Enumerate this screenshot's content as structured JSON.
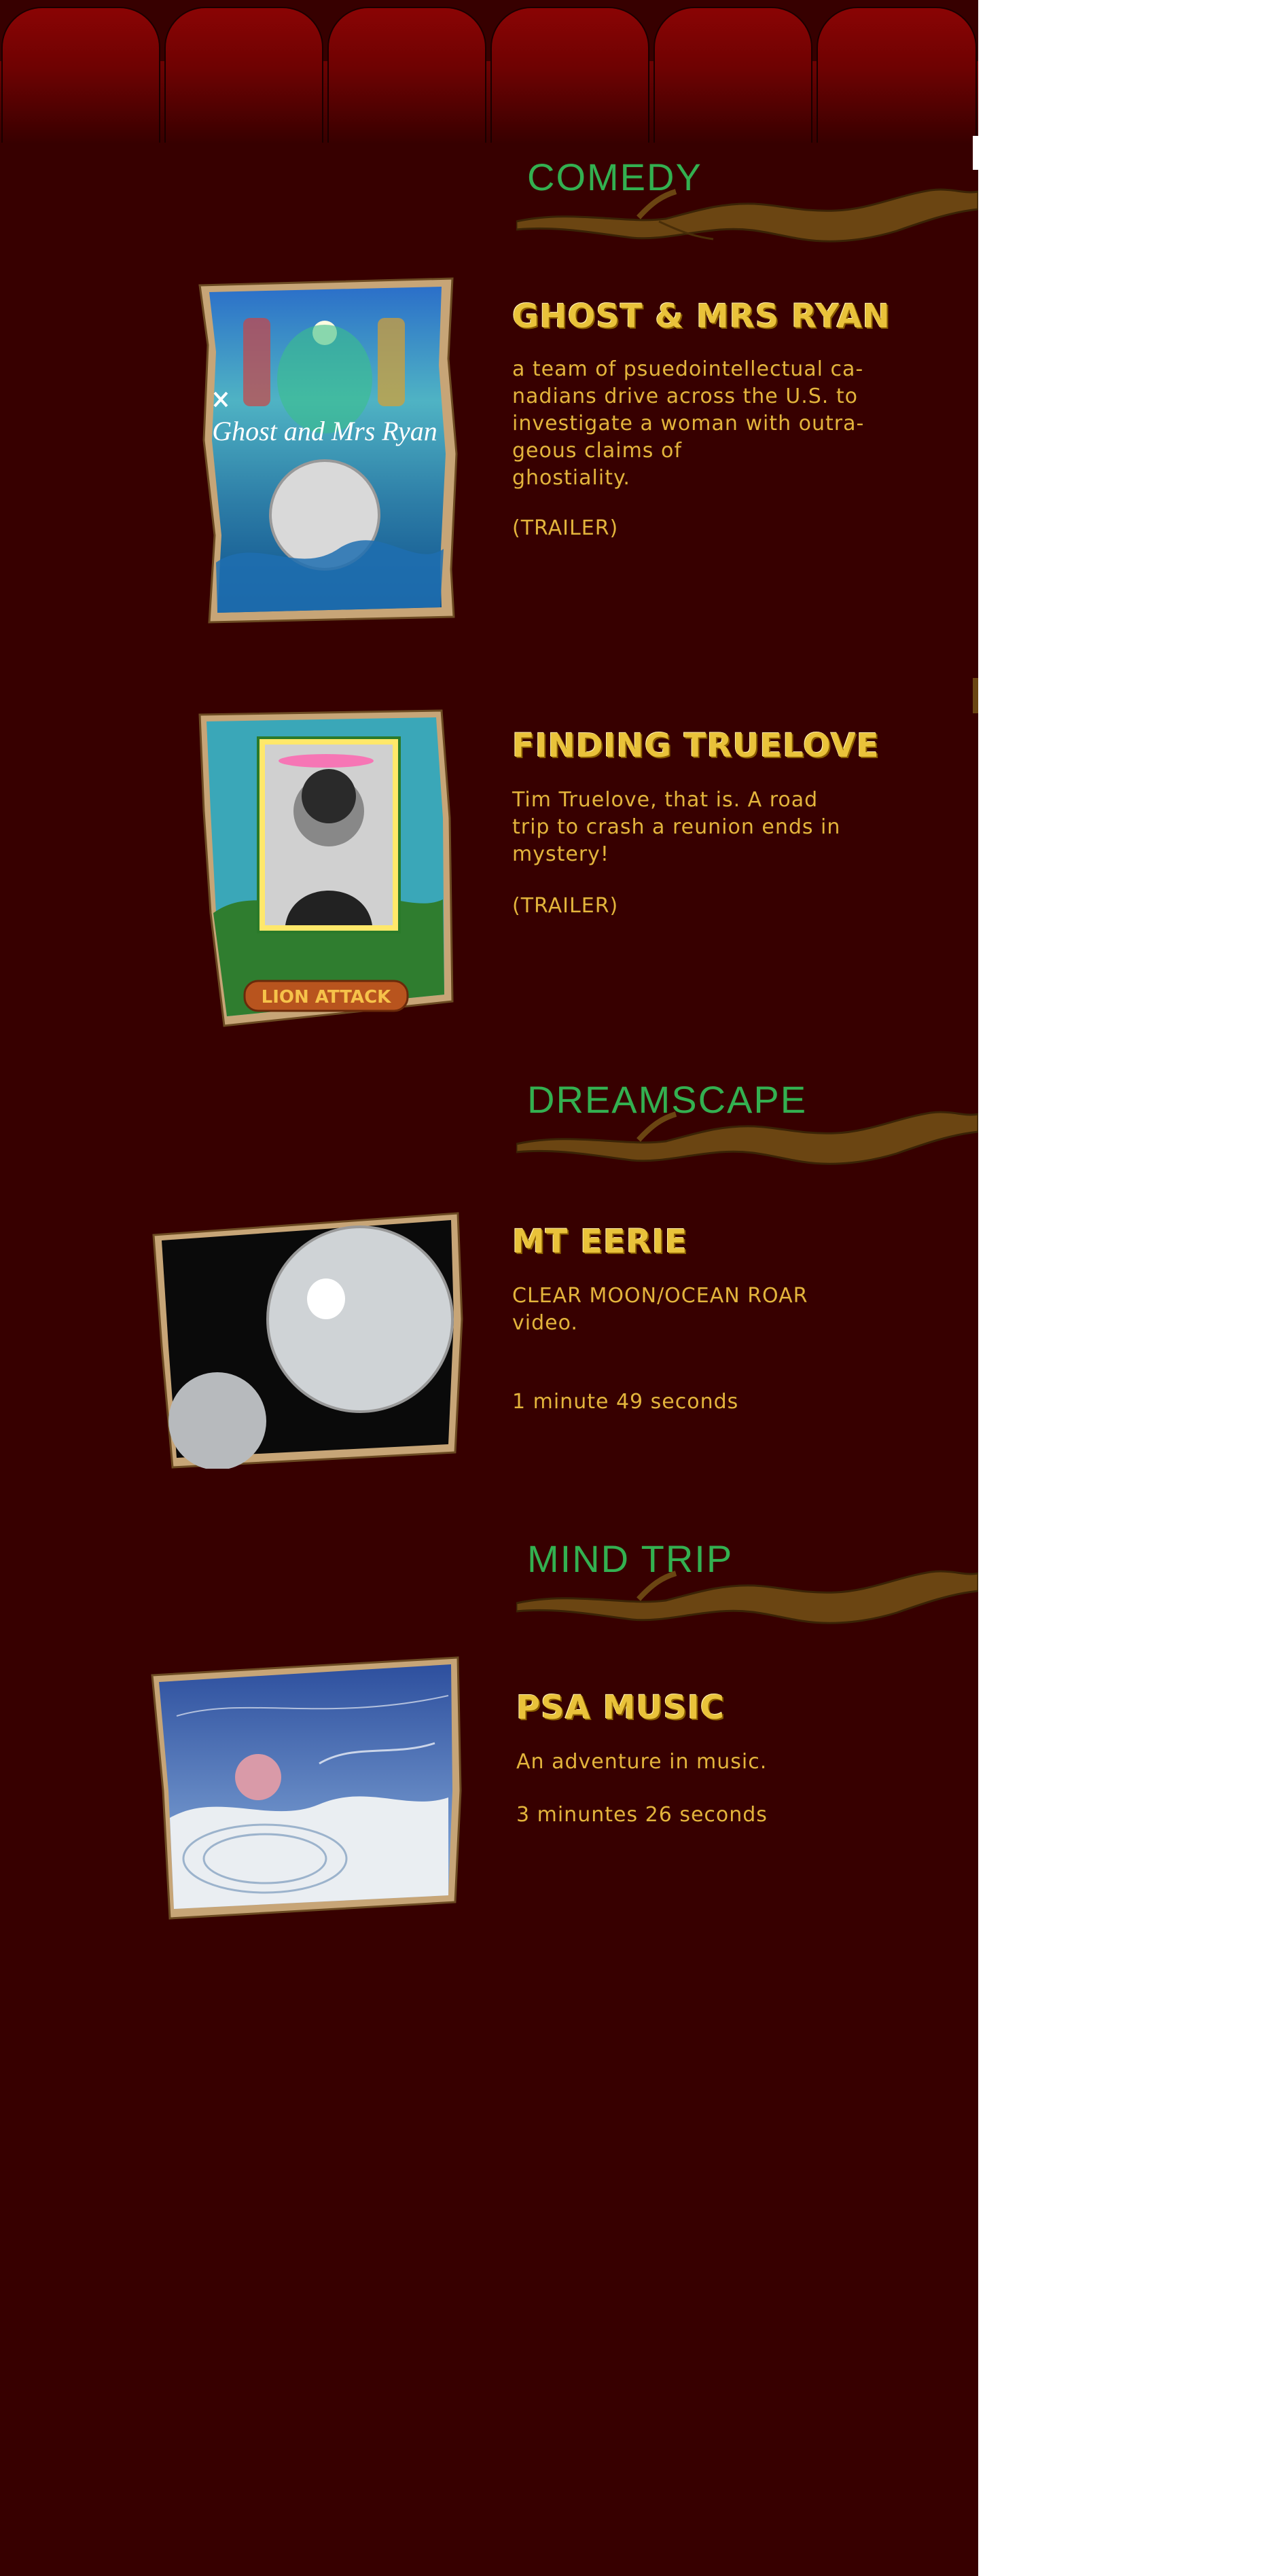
{
  "colors": {
    "panel": "#370000",
    "tab": "#8a0404",
    "section_title": "#33b050",
    "card_title": "#e9c23a",
    "card_text": "#e3b43c",
    "branch": "#6b4512"
  },
  "sections": [
    {
      "title": "COMEDY",
      "items": [
        {
          "title": "GHOST & MRS RYAN",
          "description_lines": [
            "a team of psuedointellectual ca-",
            "nadians drive across the U.S. to",
            "investigate a woman with outra-",
            "geous claims of",
            "ghostiality."
          ],
          "link": "(TRAILER)",
          "poster_text": "Ghost and Mrs Ryan"
        },
        {
          "title": "FINDING TRUELOVE",
          "description_lines": [
            "Tim Truelove, that is.  A road",
            "trip to crash a reunion ends in",
            "mystery!"
          ],
          "link": "(TRAILER)",
          "poster_text": "LION ATTACK"
        }
      ]
    },
    {
      "title": "DREAMSCAPE",
      "items": [
        {
          "title": "MT EERIE",
          "description_lines": [
            "CLEAR MOON/OCEAN ROAR",
            "video."
          ],
          "duration": "1 minute 49 seconds"
        }
      ]
    },
    {
      "title": "MIND TRIP",
      "items": [
        {
          "title": "PSA MUSIC",
          "description_lines": [
            "An adventure in music."
          ],
          "duration": "3 minuntes 26 seconds"
        }
      ]
    }
  ]
}
